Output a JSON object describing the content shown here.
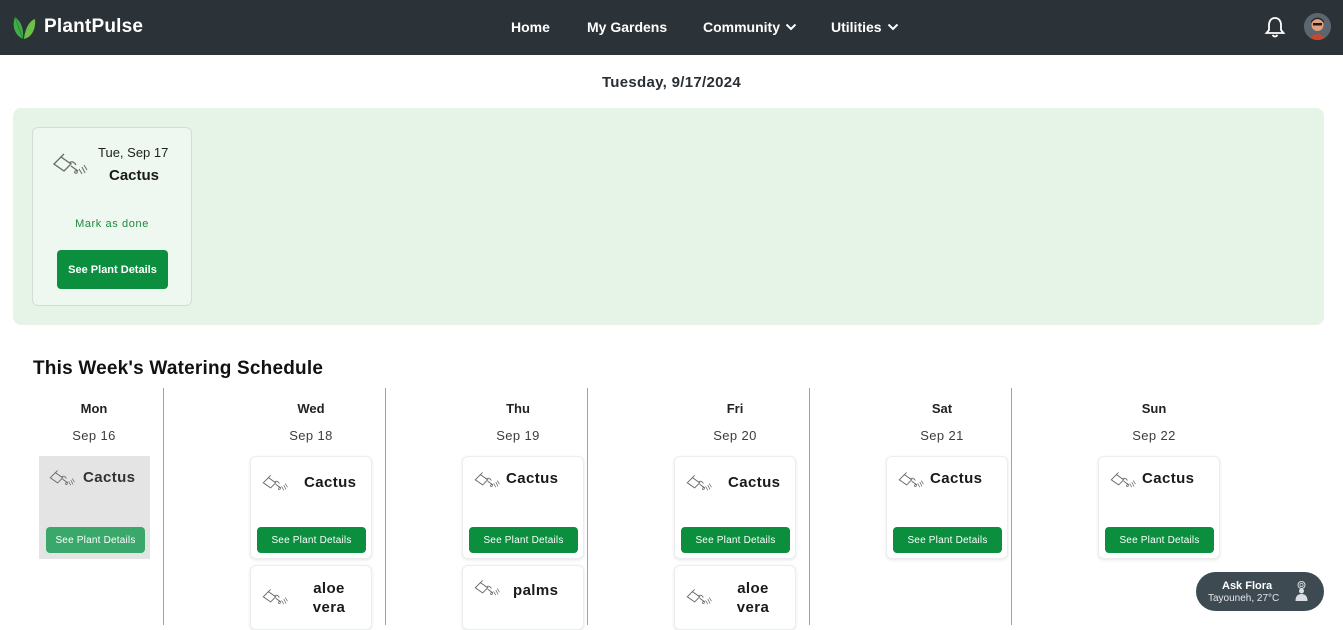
{
  "app": {
    "name": "PlantPulse",
    "brand_color": "#2b3238",
    "accent_color": "#0b8f3e"
  },
  "nav": {
    "home": "Home",
    "gardens": "My Gardens",
    "community": "Community",
    "utilities": "Utilities",
    "icons": [
      "bell-icon",
      "avatar"
    ]
  },
  "header": {
    "date": "Tuesday, 9/17/2024"
  },
  "today": {
    "date": "Tue, Sep 17",
    "plant": "Cactus",
    "mark_done": "Mark as done",
    "details_button": "See Plant Details"
  },
  "week": {
    "title": "This Week's Watering Schedule",
    "days": [
      {
        "name": "Mon",
        "date": "Sep 16",
        "plants": [
          {
            "name": "Cactus",
            "done": true,
            "button": "See Plant Details"
          }
        ]
      },
      {
        "name": "Wed",
        "date": "Sep 18",
        "plants": [
          {
            "name": "Cactus",
            "button": "See Plant Details"
          },
          {
            "name": "aloe vera"
          }
        ]
      },
      {
        "name": "Thu",
        "date": "Sep 19",
        "plants": [
          {
            "name": "Cactus",
            "button": "See Plant Details"
          },
          {
            "name": "palms"
          }
        ]
      },
      {
        "name": "Fri",
        "date": "Sep 20",
        "plants": [
          {
            "name": "Cactus",
            "button": "See Plant Details"
          },
          {
            "name": "aloe vera"
          }
        ]
      },
      {
        "name": "Sat",
        "date": "Sep 21",
        "plants": [
          {
            "name": "Cactus",
            "button": "See Plant Details"
          }
        ]
      },
      {
        "name": "Sun",
        "date": "Sep 22",
        "plants": [
          {
            "name": "Cactus",
            "button": "See Plant Details"
          }
        ]
      }
    ]
  },
  "assistant": {
    "label": "Ask Flora",
    "weather": "Tayouneh, 27°C"
  }
}
